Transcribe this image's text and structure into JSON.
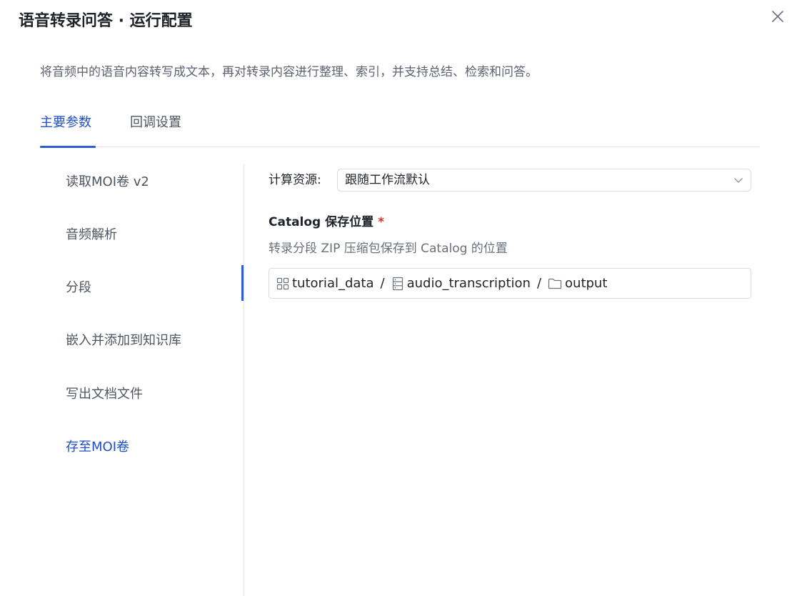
{
  "dialog": {
    "title": "语音转录问答 · 运行配置",
    "description": "将音频中的语音内容转写成文本，再对转录内容进行整理、索引，并支持总结、检索和问答。",
    "close_icon": "close-icon"
  },
  "tabs": [
    {
      "label": "主要参数",
      "active": true
    },
    {
      "label": "回调设置",
      "active": false
    }
  ],
  "nav": {
    "items": [
      {
        "label": "读取MOI卷 v2"
      },
      {
        "label": "音频解析"
      },
      {
        "label": "分段"
      },
      {
        "label": "嵌入并添加到知识库"
      },
      {
        "label": "写出文档文件"
      },
      {
        "label": "存至MOI卷"
      }
    ],
    "active_label": "存至MOI卷"
  },
  "form": {
    "compute_label": "计算资源:",
    "compute_value": "跟随工作流默认",
    "catalog_label": "Catalog 保存位置",
    "required_mark": "*",
    "catalog_help": "转录分段 ZIP 压缩包保存到 Catalog 的位置",
    "path": [
      {
        "icon": "grid-icon",
        "label": "tutorial_data"
      },
      {
        "icon": "database-icon",
        "label": "audio_transcription"
      },
      {
        "icon": "folder-icon",
        "label": "output"
      }
    ],
    "path_separator": "/"
  },
  "colors": {
    "accent": "#2e5bd8",
    "accent_text": "#1f4fc8",
    "required": "#e0312b",
    "border": "#d9dce1"
  }
}
